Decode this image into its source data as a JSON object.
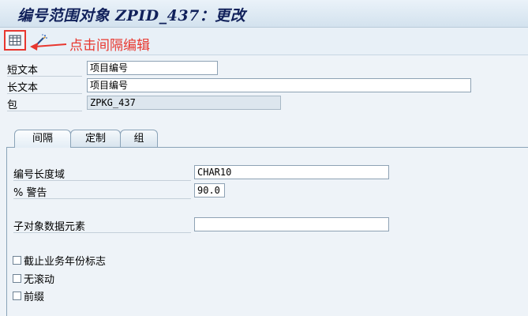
{
  "window": {
    "title": "编号范围对象 ZPID_437：更改"
  },
  "toolbar": {
    "interval_icon": "table-grid-icon",
    "edit_icon": "pencil-wand-icon"
  },
  "annotation": {
    "text": "点击间隔编辑",
    "color": "#e8372f"
  },
  "header_fields": {
    "short_text": {
      "label": "短文本",
      "value": "项目编号"
    },
    "long_text": {
      "label": "长文本",
      "value": "项目编号"
    },
    "package": {
      "label": "包",
      "value": "ZPKG_437"
    }
  },
  "tabs": [
    {
      "label": "间隔",
      "active": true
    },
    {
      "label": "定制",
      "active": false
    },
    {
      "label": "组",
      "active": false
    }
  ],
  "interval_tab": {
    "number_length_domain": {
      "label": "编号长度域",
      "value": "CHAR10"
    },
    "warning_percent": {
      "label": "% 警告",
      "value": "90.0"
    },
    "sub_object_element": {
      "label": "子对象数据元素",
      "value": ""
    },
    "checkboxes": [
      {
        "label": "截止业务年份标志",
        "checked": false
      },
      {
        "label": "无滚动",
        "checked": false
      },
      {
        "label": "前缀",
        "checked": false
      }
    ]
  }
}
